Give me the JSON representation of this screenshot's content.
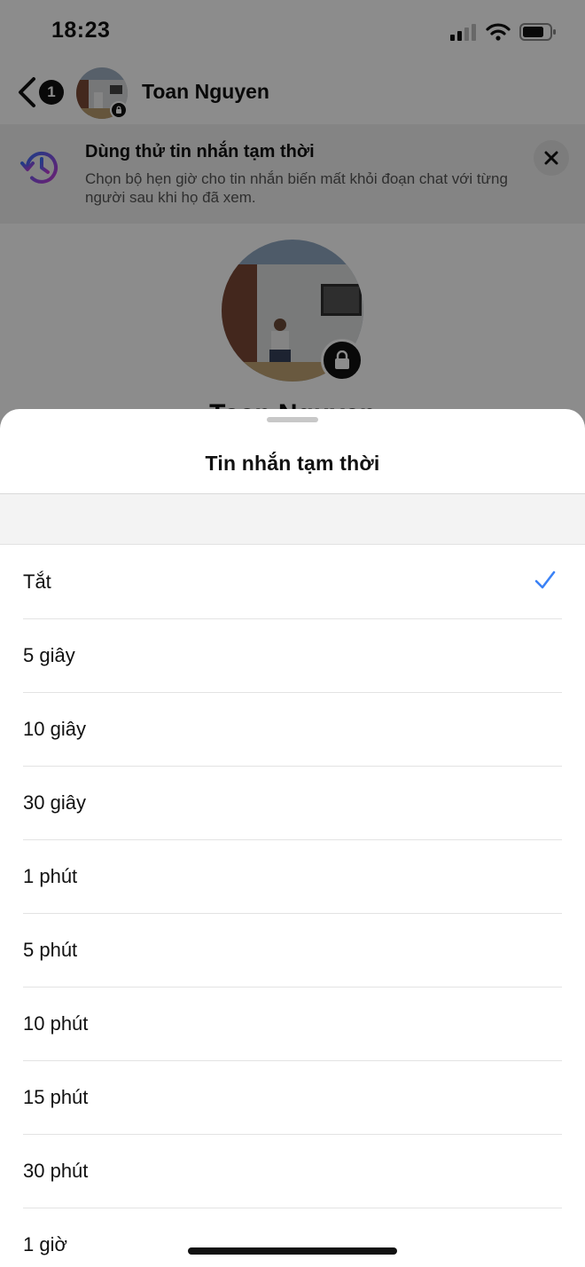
{
  "status_bar": {
    "time": "18:23"
  },
  "header": {
    "back_badge": "1",
    "contact_name": "Toan Nguyen"
  },
  "banner": {
    "title": "Dùng thử tin nhắn tạm thời",
    "text": "Chọn bộ hẹn giờ cho tin nhắn biến mất khỏi đoạn chat với từng người sau khi họ đã xem."
  },
  "profile": {
    "name": "Toan Nguyen"
  },
  "sheet": {
    "title": "Tin nhắn tạm thời",
    "accent_color": "#3b82f6",
    "options": [
      {
        "label": "Tắt",
        "selected": true
      },
      {
        "label": "5 giây",
        "selected": false
      },
      {
        "label": "10 giây",
        "selected": false
      },
      {
        "label": "30 giây",
        "selected": false
      },
      {
        "label": "1 phút",
        "selected": false
      },
      {
        "label": "5 phút",
        "selected": false
      },
      {
        "label": "10 phút",
        "selected": false
      },
      {
        "label": "15 phút",
        "selected": false
      },
      {
        "label": "30 phút",
        "selected": false
      },
      {
        "label": "1 giờ",
        "selected": false
      }
    ]
  }
}
